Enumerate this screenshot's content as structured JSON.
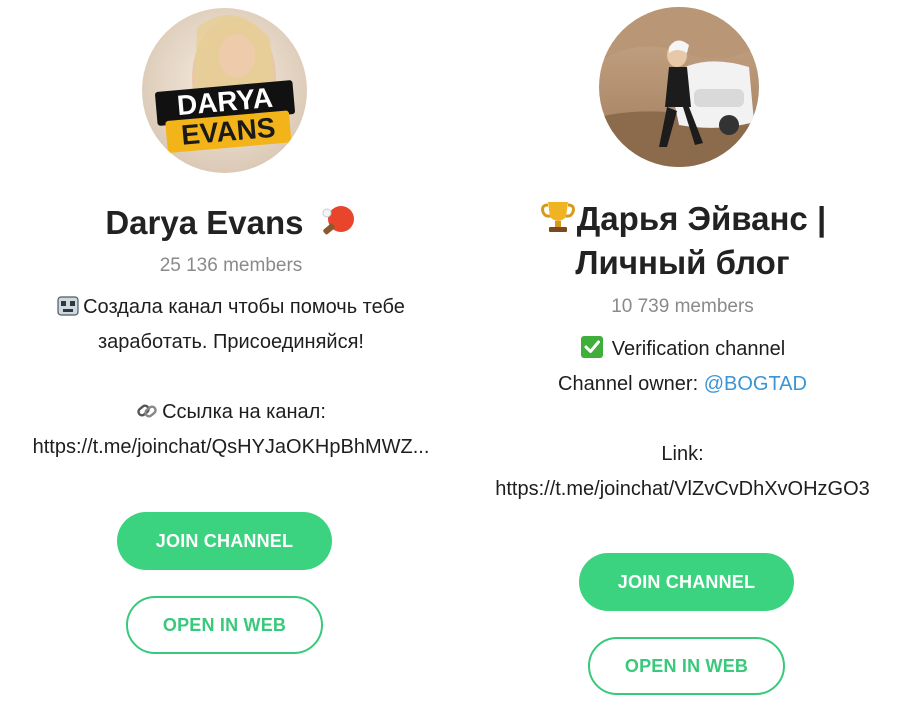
{
  "left_channel": {
    "name": "Darya Evans",
    "name_emoji": "ping-pong-icon",
    "avatar_text_line1": "DARYA",
    "avatar_text_line2": "EVANS",
    "members": "25 136 members",
    "description_line1": "Создала канал чтобы помочь тебе",
    "description_line2": "заработать. Присоединяйся!",
    "link_label": "Ссылка на канал:",
    "link_url": "https://t.me/joinchat/QsHYJaOKHpBhMWZ...",
    "join_button": "JOIN CHANNEL",
    "web_button": "OPEN IN WEB"
  },
  "right_channel": {
    "name_line1": "Дарья Эйванс |",
    "name_line2": "Личный блог",
    "members": "10 739 members",
    "verification": "Verification channel",
    "owner_label": "Channel owner:",
    "owner_handle": "@BOGTAD",
    "link_label": "Link:",
    "link_url": "https://t.me/joinchat/VlZvCvDhXvOHzGO3",
    "join_button": "JOIN CHANNEL",
    "web_button": "OPEN IN WEB"
  },
  "colors": {
    "accent": "#3bd37f",
    "link": "#3a95d6",
    "muted": "#8a8a8a"
  }
}
